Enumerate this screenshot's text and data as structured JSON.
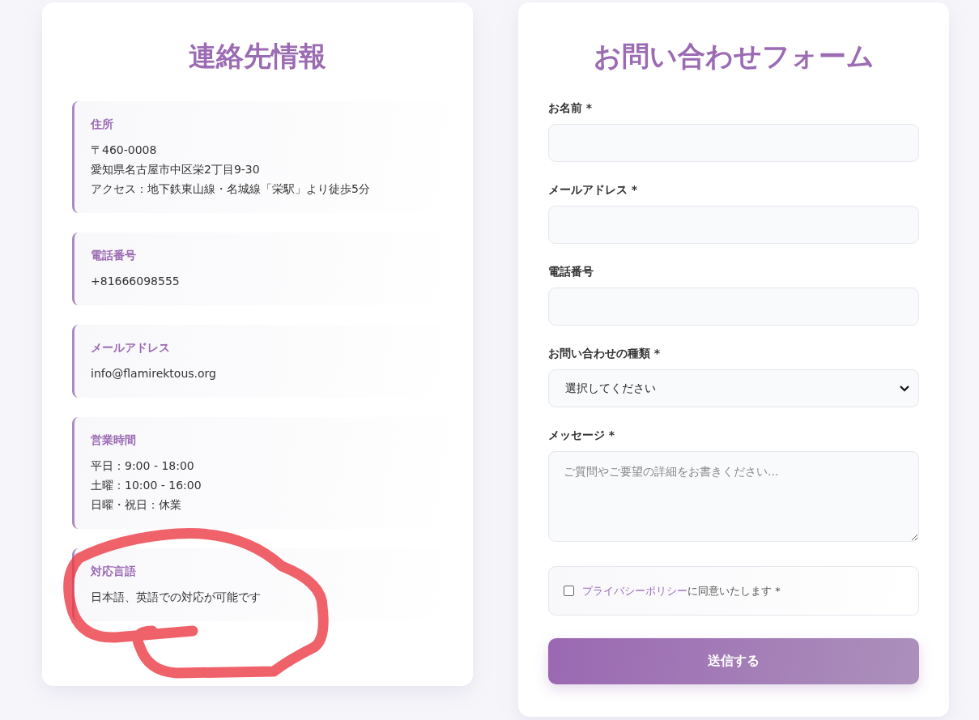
{
  "contact": {
    "title": "連絡先情報",
    "items": [
      {
        "label": "住所",
        "lines": [
          "〒460-0008",
          "愛知県名古屋市中区栄2丁目9-30",
          "アクセス：地下鉄東山線・名城線「栄駅」より徒歩5分"
        ]
      },
      {
        "label": "電話番号",
        "lines": [
          "+81666098555"
        ]
      },
      {
        "label": "メールアドレス",
        "lines": [
          "info@flamirektous.org"
        ]
      },
      {
        "label": "営業時間",
        "lines": [
          "平日：9:00 - 18:00",
          "土曜：10:00 - 16:00",
          "日曜・祝日：休業"
        ]
      },
      {
        "label": "対応言語",
        "lines": [
          "日本語、英語での対応が可能です"
        ]
      }
    ]
  },
  "form": {
    "title": "お問い合わせフォーム",
    "fields": [
      {
        "kind": "text",
        "label": "お名前 *"
      },
      {
        "kind": "text",
        "label": "メールアドレス *"
      },
      {
        "kind": "text",
        "label": "電話番号"
      },
      {
        "kind": "select",
        "label": "お問い合わせの種類 *",
        "value": "選択してください"
      },
      {
        "kind": "textarea",
        "label": "メッセージ *",
        "placeholder": "ご質問やご要望の詳細をお書きください..."
      }
    ],
    "consent": {
      "checked": false,
      "link": "プライバシーポリシー",
      "text": "に同意いたします *"
    },
    "submit": "送信する"
  }
}
